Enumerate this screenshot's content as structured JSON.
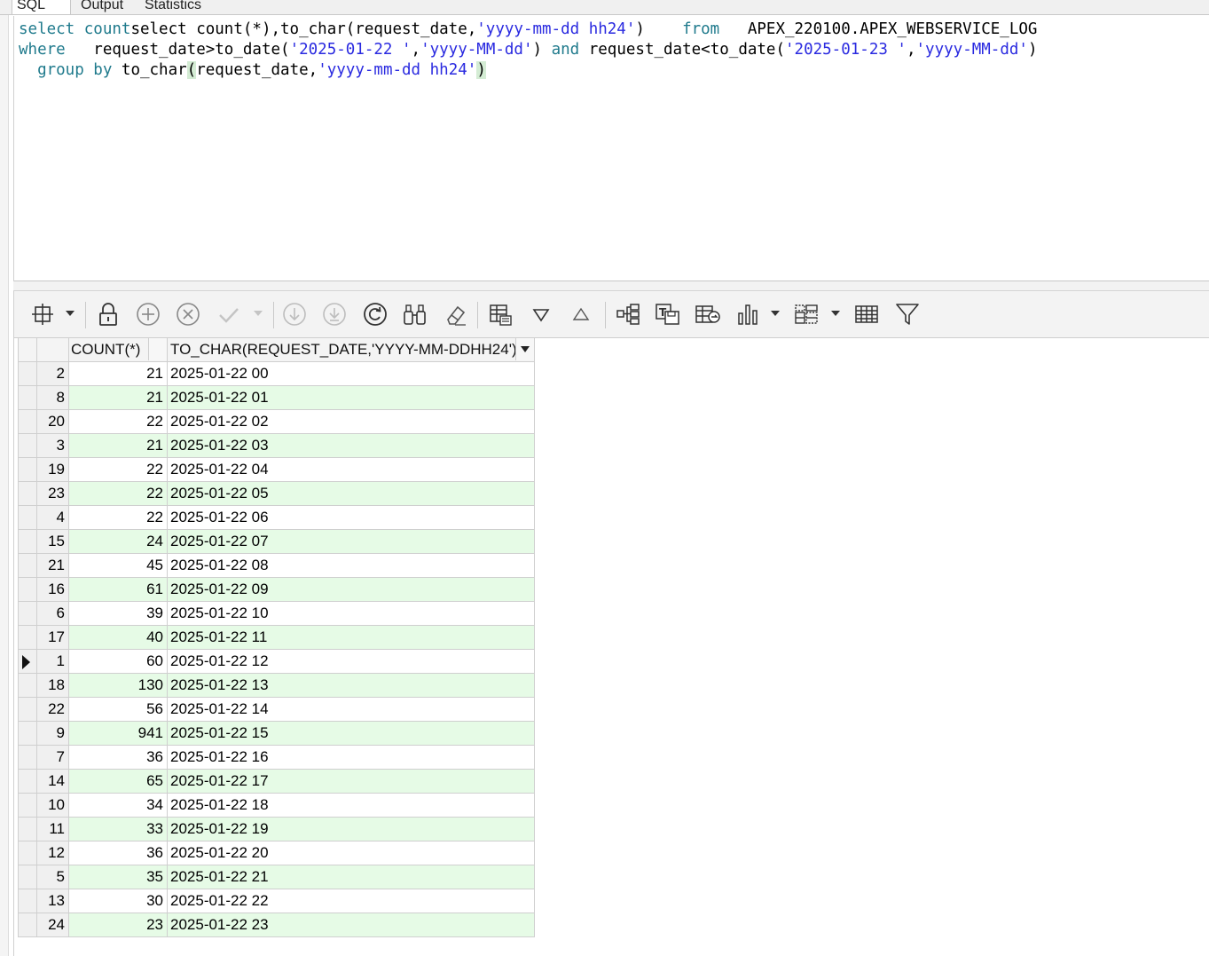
{
  "tabs": [
    {
      "label": "SQL",
      "active": true
    },
    {
      "label": "Output",
      "active": false
    },
    {
      "label": "Statistics",
      "active": false
    }
  ],
  "editor": {
    "line1": {
      "t1": "select count(*),to_char(request_date,",
      "s1": "'yyyy-mm-dd hh24'",
      "t2": ")    ",
      "k1": "from",
      "t3": "   APEX_220100.APEX_WEBSERVICE_LOG"
    },
    "line2": {
      "k1": "where",
      "t1": "   request_date>to_date(",
      "s1": "'2025-01-22 '",
      "t2": ",",
      "s2": "'yyyy-MM-dd'",
      "t3": ") ",
      "k2": "and",
      "t4": " request_date<to_date(",
      "s3": "'2025-01-23 '",
      "t5": ",",
      "s4": "'yyyy-MM-dd'",
      "t6": ")"
    },
    "line3": {
      "k1": "group by",
      "t1": " to_char",
      "p1": "(",
      "t2": "request_date,",
      "s1": "'yyyy-mm-dd hh24'",
      "p2": ")"
    }
  },
  "toolbar": {
    "icons": [
      "freeze-columns-icon",
      "lock-icon",
      "add-row-icon",
      "delete-row-icon",
      "post-edits-icon",
      "fetch-next-page-icon",
      "fetch-all-icon",
      "refresh-icon",
      "find-icon",
      "clear-icon",
      "grid-view-icon",
      "filter-down-icon",
      "filter-up-icon",
      "tree-view-icon",
      "text-export-icon",
      "export-icon",
      "chart-icon",
      "pivot-icon",
      "table-icon",
      "filter-icon"
    ]
  },
  "grid": {
    "columns": [
      "COUNT(*)",
      "TO_CHAR(REQUEST_DATE,'YYYY-MM-DDHH24')"
    ],
    "current_row_index": 12,
    "rows": [
      {
        "rn": "2",
        "count": "21",
        "date": "2025-01-22 00"
      },
      {
        "rn": "8",
        "count": "21",
        "date": "2025-01-22 01"
      },
      {
        "rn": "20",
        "count": "22",
        "date": "2025-01-22 02"
      },
      {
        "rn": "3",
        "count": "21",
        "date": "2025-01-22 03"
      },
      {
        "rn": "19",
        "count": "22",
        "date": "2025-01-22 04"
      },
      {
        "rn": "23",
        "count": "22",
        "date": "2025-01-22 05"
      },
      {
        "rn": "4",
        "count": "22",
        "date": "2025-01-22 06"
      },
      {
        "rn": "15",
        "count": "24",
        "date": "2025-01-22 07"
      },
      {
        "rn": "21",
        "count": "45",
        "date": "2025-01-22 08"
      },
      {
        "rn": "16",
        "count": "61",
        "date": "2025-01-22 09"
      },
      {
        "rn": "6",
        "count": "39",
        "date": "2025-01-22 10"
      },
      {
        "rn": "17",
        "count": "40",
        "date": "2025-01-22 11"
      },
      {
        "rn": "1",
        "count": "60",
        "date": "2025-01-22 12"
      },
      {
        "rn": "18",
        "count": "130",
        "date": "2025-01-22 13"
      },
      {
        "rn": "22",
        "count": "56",
        "date": "2025-01-22 14"
      },
      {
        "rn": "9",
        "count": "941",
        "date": "2025-01-22 15"
      },
      {
        "rn": "7",
        "count": "36",
        "date": "2025-01-22 16"
      },
      {
        "rn": "14",
        "count": "65",
        "date": "2025-01-22 17"
      },
      {
        "rn": "10",
        "count": "34",
        "date": "2025-01-22 18"
      },
      {
        "rn": "11",
        "count": "33",
        "date": "2025-01-22 19"
      },
      {
        "rn": "12",
        "count": "36",
        "date": "2025-01-22 20"
      },
      {
        "rn": "5",
        "count": "35",
        "date": "2025-01-22 21"
      },
      {
        "rn": "13",
        "count": "30",
        "date": "2025-01-22 22"
      },
      {
        "rn": "24",
        "count": "23",
        "date": "2025-01-22 23"
      }
    ]
  },
  "colors": {
    "keyword": "#1f7a8c",
    "string": "#2a2ae0",
    "alt_row": "#e6fbe6",
    "bracket_highlight": "#d4ecd4"
  }
}
